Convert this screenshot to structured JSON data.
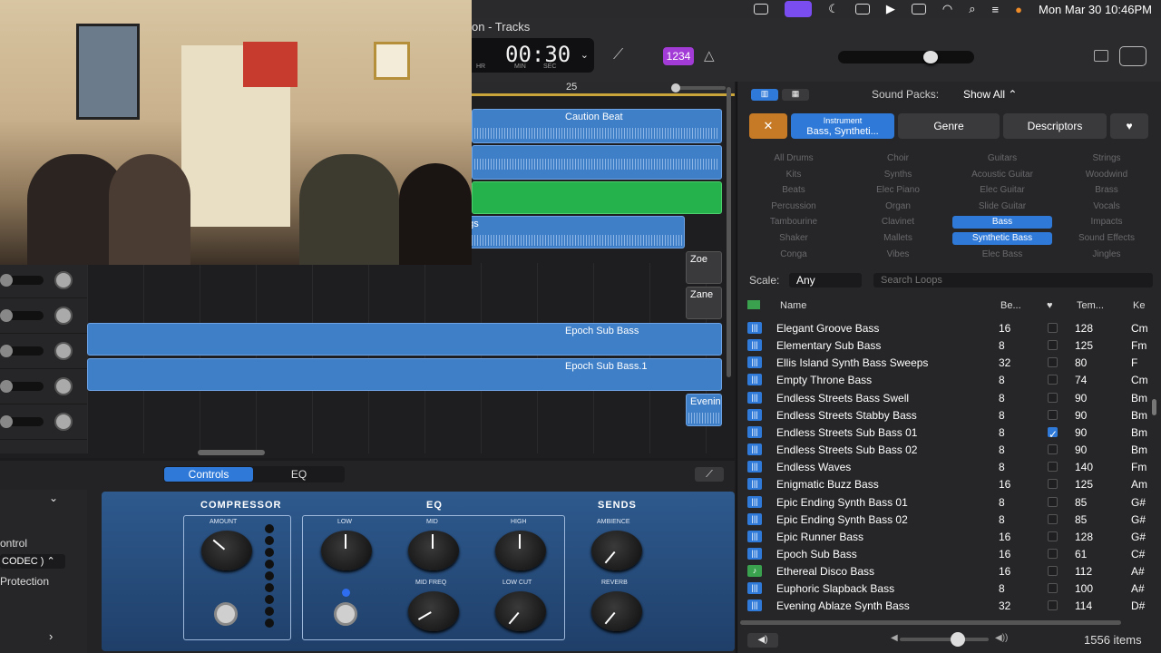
{
  "menubar": {
    "clock": "Mon Mar 30  10:46PM"
  },
  "window": {
    "title": "on - Tracks"
  },
  "lcd": {
    "time": "00:30",
    "l_hr": "HR",
    "l_min": "MIN",
    "l_sec": "SEC"
  },
  "toolbar": {
    "count_in": "1234"
  },
  "ruler": {
    "bar": "25"
  },
  "regions": {
    "caution": "Caution Beat",
    "songs": "ngs",
    "zoe": "Zoe",
    "zane": "Zane",
    "epoch1": "Epoch Sub Bass",
    "epoch2": "Epoch Sub Bass.1",
    "evening": "Evenin"
  },
  "smart_controls": {
    "tab_controls": "Controls",
    "tab_eq": "EQ"
  },
  "inspector": {
    "control": "ontrol",
    "codec": "CODEC )",
    "protection": "Protection"
  },
  "plugin": {
    "compressor": "COMPRESSOR",
    "eq": "EQ",
    "sends": "SENDS",
    "amount": "AMOUNT",
    "low": "LOW",
    "mid": "MID",
    "high": "HIGH",
    "mid_freq": "MID FREQ",
    "low_cut": "LOW CUT",
    "ambience": "AMBIENCE",
    "reverb": "REVERB"
  },
  "browser": {
    "sound_packs_label": "Sound Packs:",
    "sound_packs_value": "Show All",
    "filter_instrument_label": "Instrument",
    "filter_instrument_value": "Bass, Syntheti...",
    "filter_genre": "Genre",
    "filter_descriptors": "Descriptors",
    "keywords": [
      [
        "All Drums",
        "Choir",
        "Guitars",
        "Strings"
      ],
      [
        "Kits",
        "Synths",
        "Acoustic Guitar",
        "Woodwind"
      ],
      [
        "Beats",
        "Elec Piano",
        "Elec Guitar",
        "Brass"
      ],
      [
        "Percussion",
        "Organ",
        "Slide Guitar",
        "Vocals"
      ],
      [
        "Tambourine",
        "Clavinet",
        "Bass",
        "Impacts"
      ],
      [
        "Shaker",
        "Mallets",
        "Synthetic Bass",
        "Sound Effects"
      ],
      [
        "Conga",
        "Vibes",
        "Elec Bass",
        "Jingles"
      ]
    ],
    "scale_label": "Scale:",
    "scale_value": "Any",
    "search_placeholder": "Search Loops",
    "col_name": "Name",
    "col_beats": "Be...",
    "col_tempo": "Tem...",
    "col_key": "Ke",
    "rows": [
      {
        "name": "Elegant Groove Bass",
        "beats": "16",
        "fav": false,
        "tempo": "128",
        "key": "Cm",
        "type": "audio"
      },
      {
        "name": "Elementary Sub Bass",
        "beats": "8",
        "fav": false,
        "tempo": "125",
        "key": "Fm",
        "type": "audio"
      },
      {
        "name": "Ellis Island Synth Bass Sweeps",
        "beats": "32",
        "fav": false,
        "tempo": "80",
        "key": "F",
        "type": "audio"
      },
      {
        "name": "Empty Throne Bass",
        "beats": "8",
        "fav": false,
        "tempo": "74",
        "key": "Cm",
        "type": "audio"
      },
      {
        "name": "Endless Streets Bass Swell",
        "beats": "8",
        "fav": false,
        "tempo": "90",
        "key": "Bm",
        "type": "audio"
      },
      {
        "name": "Endless Streets Stabby Bass",
        "beats": "8",
        "fav": false,
        "tempo": "90",
        "key": "Bm",
        "type": "audio"
      },
      {
        "name": "Endless Streets Sub Bass 01",
        "beats": "8",
        "fav": true,
        "tempo": "90",
        "key": "Bm",
        "type": "audio"
      },
      {
        "name": "Endless Streets Sub Bass 02",
        "beats": "8",
        "fav": false,
        "tempo": "90",
        "key": "Bm",
        "type": "audio"
      },
      {
        "name": "Endless Waves",
        "beats": "8",
        "fav": false,
        "tempo": "140",
        "key": "Fm",
        "type": "audio"
      },
      {
        "name": "Enigmatic Buzz Bass",
        "beats": "16",
        "fav": false,
        "tempo": "125",
        "key": "Am",
        "type": "audio"
      },
      {
        "name": "Epic Ending Synth Bass 01",
        "beats": "8",
        "fav": false,
        "tempo": "85",
        "key": "G#",
        "type": "audio"
      },
      {
        "name": "Epic Ending Synth Bass 02",
        "beats": "8",
        "fav": false,
        "tempo": "85",
        "key": "G#",
        "type": "audio"
      },
      {
        "name": "Epic Runner Bass",
        "beats": "16",
        "fav": false,
        "tempo": "128",
        "key": "G#",
        "type": "audio"
      },
      {
        "name": "Epoch Sub Bass",
        "beats": "16",
        "fav": false,
        "tempo": "61",
        "key": "C#",
        "type": "audio"
      },
      {
        "name": "Ethereal Disco Bass",
        "beats": "16",
        "fav": false,
        "tempo": "112",
        "key": "A#",
        "type": "midi"
      },
      {
        "name": "Euphoric Slapback Bass",
        "beats": "8",
        "fav": false,
        "tempo": "100",
        "key": "A#",
        "type": "audio"
      },
      {
        "name": "Evening Ablaze Synth Bass",
        "beats": "32",
        "fav": false,
        "tempo": "114",
        "key": "D#",
        "type": "audio"
      }
    ],
    "item_count": "1556 items"
  }
}
